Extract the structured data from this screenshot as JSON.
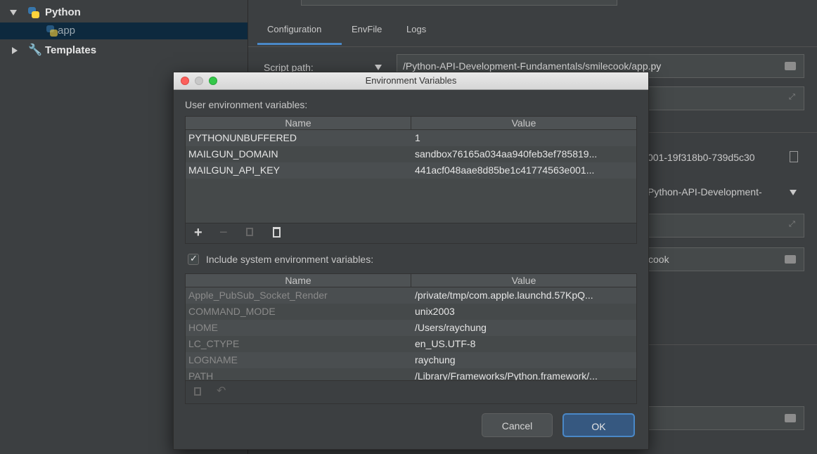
{
  "tree": {
    "python_label": "Python",
    "app_label": "app",
    "templates_label": "Templates"
  },
  "config": {
    "tabs": [
      "Configuration",
      "EnvFile",
      "Logs"
    ],
    "script_path_label": "Script path:",
    "script_path_value": "/Python-API-Development-Fundamentals/smilecook/app.py",
    "env_partial": "001-19f318b0-739d5c30",
    "interpreter_partial": "Python-API-Development-",
    "workdir_partial": "cook"
  },
  "dialog": {
    "title": "Environment Variables",
    "user_section_label": "User environment variables:",
    "columns": [
      "Name",
      "Value"
    ],
    "user_vars": [
      {
        "name": "PYTHONUNBUFFERED",
        "value": "1"
      },
      {
        "name": "MAILGUN_DOMAIN",
        "value": "sandbox76165a034aa940feb3ef785819..."
      },
      {
        "name": "MAILGUN_API_KEY",
        "value": "441acf048aae8d85be1c41774563e001..."
      }
    ],
    "include_system_label": "Include system environment variables:",
    "include_system_checked": true,
    "system_vars": [
      {
        "name": "Apple_PubSub_Socket_Render",
        "value": "/private/tmp/com.apple.launchd.57KpQ..."
      },
      {
        "name": "COMMAND_MODE",
        "value": "unix2003"
      },
      {
        "name": "HOME",
        "value": "/Users/raychung"
      },
      {
        "name": "LC_CTYPE",
        "value": "en_US.UTF-8"
      },
      {
        "name": "LOGNAME",
        "value": "raychung"
      },
      {
        "name": "PATH",
        "value": "/Library/Frameworks/Python.framework/..."
      }
    ],
    "cancel_label": "Cancel",
    "ok_label": "OK"
  },
  "colors": {
    "accent": "#2f65ca",
    "panel_bg": "#3c3f41",
    "selection": "#0d293e"
  }
}
